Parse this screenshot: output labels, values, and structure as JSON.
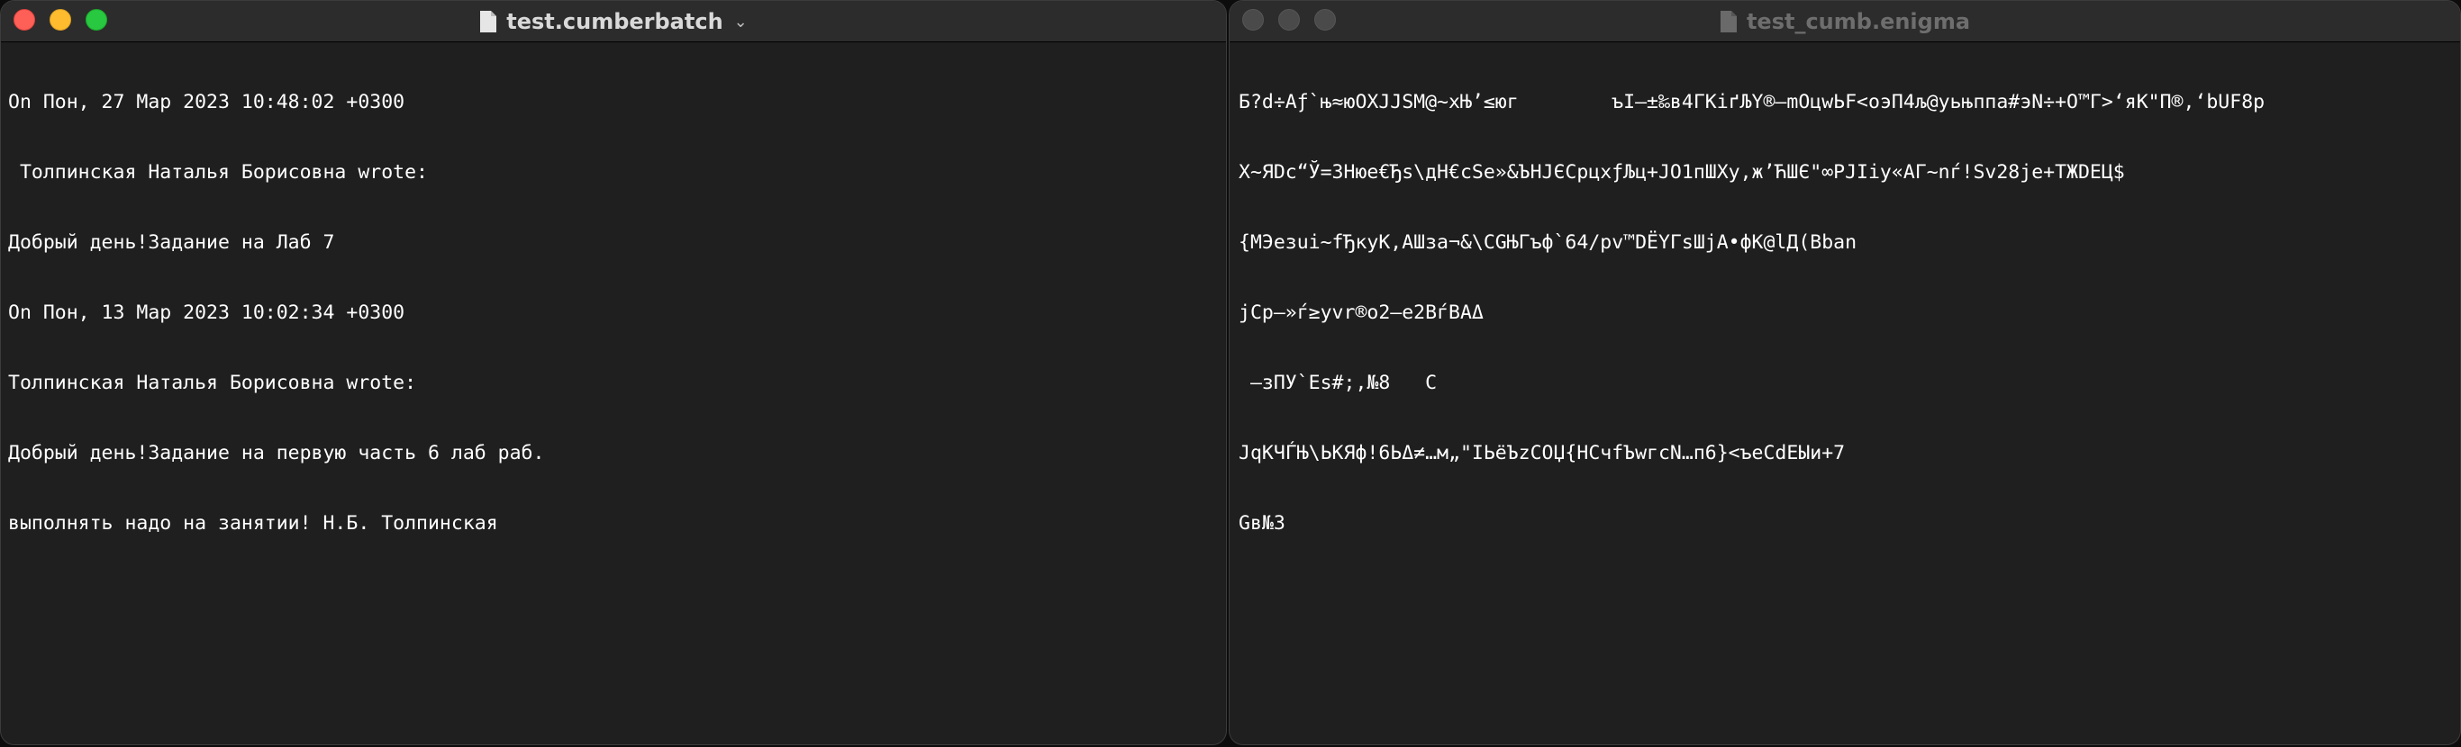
{
  "left_window": {
    "title": "test.cumberbatch",
    "lines": [
      "On Пон, 27 Мар 2023 10:48:02 +0300",
      " Толпинская Наталья Борисовна wrote:",
      "Добрый день!Задание на Лаб 7",
      "On Пон, 13 Мар 2023 10:02:34 +0300",
      "Толпинская Наталья Борисовна wrote:",
      "Добрый день!Задание на первую часть 6 лаб раб.",
      "выполнять надо на занятии! Н.Б. Толпинская"
    ]
  },
  "right_window": {
    "title": "test_cumb.enigma",
    "lines": [
      "Б?d÷Аƒ`њ≈юОXJJSM@~xЊ’≤юг        ъI—±‰в4ГКiґЉҮ®—mОцwЬF<оэП4љ@уьњппа#эN÷+О™Г>‘яК\"П®,‘bUF8р",
      "Х~ЯDс“Ў=3Нюе€Ђs\\дН€cSe»&ЪНJЄСрцхƒЉц+JО1пШХу,ж’ЋШЄ\"∞РJIiу«АГ~nѓ!Sv28je+ТЖDЕЦ$",
      "{МЭезui~fЂкуК,AШза¬&\\СGЊГъф`64/pv™DЁYГsШjА•фК@lД(Bban",
      "jСр—»ѓ≥уvr®о2—е2ВѓВАΔ",
      " —зПУ`Es#;,№8   С",
      "JqКЧЃЊ\\ЬКЯф!6ЬΔ≠…м„\"IЬёЪzСОЏ{НСчfЪwгсN…п6}<ъеСdЕЫи+7",
      "Gв№3"
    ]
  }
}
